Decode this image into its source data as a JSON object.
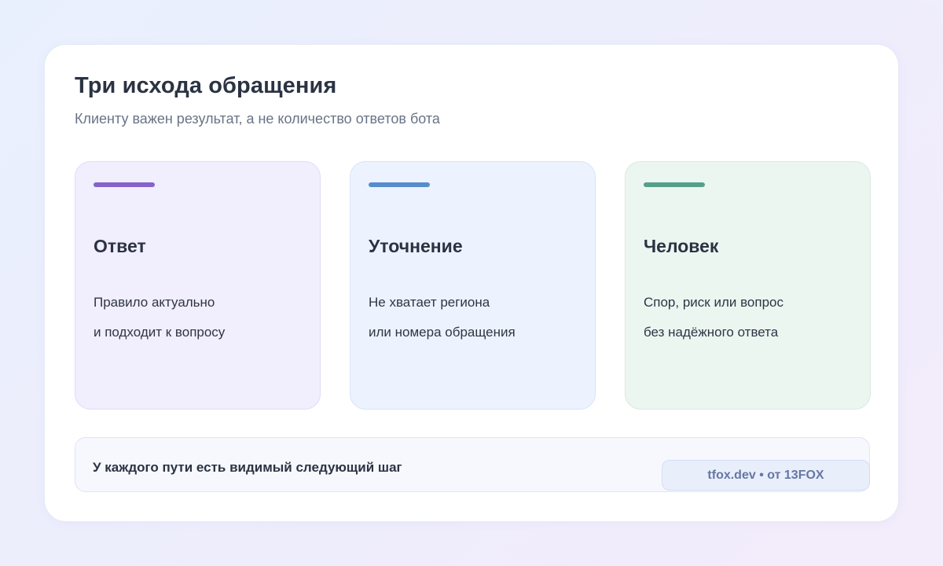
{
  "header": {
    "title": "Три исхода обращения",
    "subtitle": "Клиенту важен результат, а не количество ответов бота"
  },
  "options": [
    {
      "name": "Ответ",
      "lines": [
        "Правило актуально",
        "и подходит к вопросу"
      ],
      "accent": "#8662c9"
    },
    {
      "name": "Уточнение",
      "lines": [
        "Не хватает региона",
        "или номера обращения"
      ],
      "accent": "#5a8ccc"
    },
    {
      "name": "Человек",
      "lines": [
        "Спор, риск или вопрос",
        "без надёжного ответа"
      ],
      "accent": "#55a08a"
    }
  ],
  "footer": {
    "note": "У каждого пути есть видимый следующий шаг",
    "credit": "tfox.dev • от 13FOX"
  }
}
